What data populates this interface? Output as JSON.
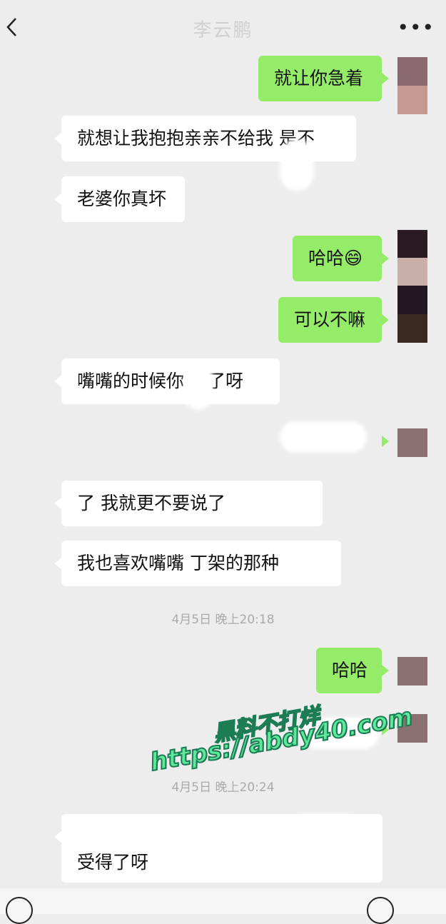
{
  "header": {
    "title": "李云鹏",
    "back_icon": "chevron-left-icon",
    "more_label": "•••"
  },
  "messages": [
    {
      "side": "right",
      "text": "就让你急着"
    },
    {
      "side": "left",
      "text": "就想让我抱抱亲亲不给我 是不"
    },
    {
      "side": "left",
      "text": "老婆你真坏"
    },
    {
      "side": "right",
      "text": "哈哈😄"
    },
    {
      "side": "right",
      "text": "可以不嘛"
    },
    {
      "side": "left",
      "text": "嘴嘴的时候你 得了呀"
    },
    {
      "side": "right",
      "text": ""
    },
    {
      "side": "left",
      "text": "                了 我就更不要说了"
    },
    {
      "side": "left",
      "text": "我也喜欢嘴嘴          丁架的那种"
    },
    {
      "side": "right",
      "text": "哈哈"
    },
    {
      "side": "left",
      "text": "受得了呀"
    }
  ],
  "timestamps": [
    "4月5日 晚上20:18",
    "4月5日 晚上20:24"
  ],
  "watermark": {
    "line1": "黑料不打烊",
    "line2": "https://abdy40.com"
  },
  "bottom": {
    "voice_icon": "voice-icon",
    "emoji_icon": "emoji-icon"
  }
}
